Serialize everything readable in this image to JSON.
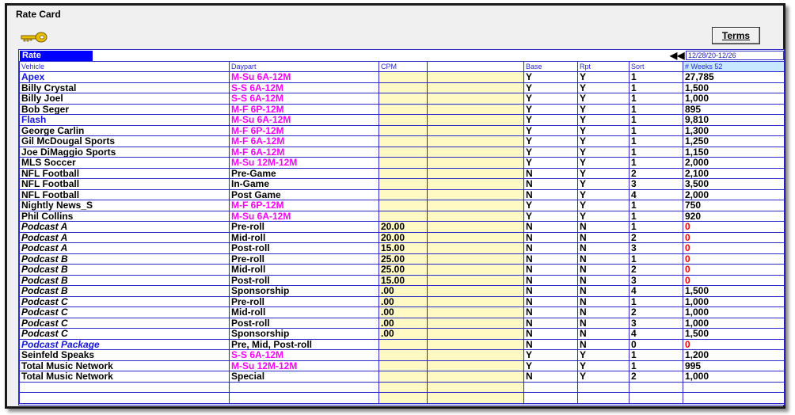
{
  "window": {
    "title": "Rate Card"
  },
  "toolbar": {
    "terms_label": "Terms",
    "key_icon": "key-icon"
  },
  "grid": {
    "tab_label": "Rate",
    "date_range": "12/28/20-12/26",
    "columns": [
      "Vehicle",
      "Daypart",
      "CPM",
      "",
      "Base",
      "Rpt",
      "Sort",
      "# Weeks 52"
    ],
    "colors": {
      "link_blue": "#1515e0",
      "daypart_magenta": "#ff00ff",
      "zero_red": "#ff0000",
      "cpm_fill": "#fff9c4",
      "grid_line": "#2a2ad0"
    },
    "rows": [
      {
        "vehicle": "Apex",
        "vehicle_style": "blue",
        "daypart": "M-Su 6A-12M",
        "daypart_style": "magenta",
        "cpm": "",
        "base": "Y",
        "rpt": "Y",
        "sort": "1",
        "weeks": "27,785",
        "weeks_style": ""
      },
      {
        "vehicle": "Billy Crystal",
        "vehicle_style": "",
        "daypart": "S-S 6A-12M",
        "daypart_style": "magenta",
        "cpm": "",
        "base": "Y",
        "rpt": "Y",
        "sort": "1",
        "weeks": "1,500",
        "weeks_style": ""
      },
      {
        "vehicle": "Billy Joel",
        "vehicle_style": "",
        "daypart": "S-S 6A-12M",
        "daypart_style": "magenta",
        "cpm": "",
        "base": "Y",
        "rpt": "Y",
        "sort": "1",
        "weeks": "1,000",
        "weeks_style": ""
      },
      {
        "vehicle": "Bob Seger",
        "vehicle_style": "",
        "daypart": "M-F 6P-12M",
        "daypart_style": "magenta",
        "cpm": "",
        "base": "Y",
        "rpt": "Y",
        "sort": "1",
        "weeks": "895",
        "weeks_style": ""
      },
      {
        "vehicle": "Flash",
        "vehicle_style": "blue",
        "daypart": "M-Su 6A-12M",
        "daypart_style": "magenta",
        "cpm": "",
        "base": "Y",
        "rpt": "Y",
        "sort": "1",
        "weeks": "9,810",
        "weeks_style": ""
      },
      {
        "vehicle": "George Carlin",
        "vehicle_style": "",
        "daypart": "M-F 6P-12M",
        "daypart_style": "magenta",
        "cpm": "",
        "base": "Y",
        "rpt": "Y",
        "sort": "1",
        "weeks": "1,300",
        "weeks_style": ""
      },
      {
        "vehicle": "Gil McDougal Sports",
        "vehicle_style": "",
        "daypart": "M-F 6A-12M",
        "daypart_style": "magenta",
        "cpm": "",
        "base": "Y",
        "rpt": "Y",
        "sort": "1",
        "weeks": "1,250",
        "weeks_style": ""
      },
      {
        "vehicle": "Joe DiMaggio Sports",
        "vehicle_style": "",
        "daypart": "M-F 6A-12M",
        "daypart_style": "magenta",
        "cpm": "",
        "base": "Y",
        "rpt": "Y",
        "sort": "1",
        "weeks": "1,150",
        "weeks_style": ""
      },
      {
        "vehicle": "MLS Soccer",
        "vehicle_style": "",
        "daypart": "M-Su 12M-12M",
        "daypart_style": "magenta",
        "cpm": "",
        "base": "Y",
        "rpt": "Y",
        "sort": "1",
        "weeks": "2,000",
        "weeks_style": ""
      },
      {
        "vehicle": "NFL Football",
        "vehicle_style": "",
        "daypart": "Pre-Game",
        "daypart_style": "",
        "cpm": "",
        "base": "N",
        "rpt": "Y",
        "sort": "2",
        "weeks": "2,100",
        "weeks_style": ""
      },
      {
        "vehicle": "NFL Football",
        "vehicle_style": "",
        "daypart": "In-Game",
        "daypart_style": "",
        "cpm": "",
        "base": "N",
        "rpt": "Y",
        "sort": "3",
        "weeks": "3,500",
        "weeks_style": ""
      },
      {
        "vehicle": "NFL Football",
        "vehicle_style": "",
        "daypart": "Post Game",
        "daypart_style": "",
        "cpm": "",
        "base": "N",
        "rpt": "Y",
        "sort": "4",
        "weeks": "2,000",
        "weeks_style": ""
      },
      {
        "vehicle": "Nightly News_S",
        "vehicle_style": "",
        "daypart": "M-F 6P-12M",
        "daypart_style": "magenta",
        "cpm": "",
        "base": "Y",
        "rpt": "Y",
        "sort": "1",
        "weeks": "750",
        "weeks_style": ""
      },
      {
        "vehicle": "Phil Collins",
        "vehicle_style": "",
        "daypart": "M-Su 6A-12M",
        "daypart_style": "magenta",
        "cpm": "",
        "base": "Y",
        "rpt": "Y",
        "sort": "1",
        "weeks": "920",
        "weeks_style": ""
      },
      {
        "vehicle": "Podcast A",
        "vehicle_style": "italic",
        "daypart": "Pre-roll",
        "daypart_style": "",
        "cpm": "20.00",
        "base": "N",
        "rpt": "N",
        "sort": "1",
        "weeks": "0",
        "weeks_style": "red"
      },
      {
        "vehicle": "Podcast A",
        "vehicle_style": "italic",
        "daypart": "Mid-roll",
        "daypart_style": "",
        "cpm": "20.00",
        "base": "N",
        "rpt": "N",
        "sort": "2",
        "weeks": "0",
        "weeks_style": "red"
      },
      {
        "vehicle": "Podcast A",
        "vehicle_style": "italic",
        "daypart": "Post-roll",
        "daypart_style": "",
        "cpm": "15.00",
        "base": "N",
        "rpt": "N",
        "sort": "3",
        "weeks": "0",
        "weeks_style": "red"
      },
      {
        "vehicle": "Podcast B",
        "vehicle_style": "italic",
        "daypart": "Pre-roll",
        "daypart_style": "",
        "cpm": "25.00",
        "base": "N",
        "rpt": "N",
        "sort": "1",
        "weeks": "0",
        "weeks_style": "red"
      },
      {
        "vehicle": "Podcast B",
        "vehicle_style": "italic",
        "daypart": "Mid-roll",
        "daypart_style": "",
        "cpm": "25.00",
        "base": "N",
        "rpt": "N",
        "sort": "2",
        "weeks": "0",
        "weeks_style": "red"
      },
      {
        "vehicle": "Podcast B",
        "vehicle_style": "italic",
        "daypart": "Post-roll",
        "daypart_style": "",
        "cpm": "15.00",
        "base": "N",
        "rpt": "N",
        "sort": "3",
        "weeks": "0",
        "weeks_style": "red"
      },
      {
        "vehicle": "Podcast B",
        "vehicle_style": "italic",
        "daypart": "Sponsorship",
        "daypart_style": "",
        "cpm": ".00",
        "base": "N",
        "rpt": "N",
        "sort": "4",
        "weeks": "1,500",
        "weeks_style": ""
      },
      {
        "vehicle": "Podcast C",
        "vehicle_style": "italic",
        "daypart": "Pre-roll",
        "daypart_style": "",
        "cpm": ".00",
        "base": "N",
        "rpt": "N",
        "sort": "1",
        "weeks": "1,000",
        "weeks_style": ""
      },
      {
        "vehicle": "Podcast C",
        "vehicle_style": "italic",
        "daypart": "Mid-roll",
        "daypart_style": "",
        "cpm": ".00",
        "base": "N",
        "rpt": "N",
        "sort": "2",
        "weeks": "1,000",
        "weeks_style": ""
      },
      {
        "vehicle": "Podcast C",
        "vehicle_style": "italic",
        "daypart": "Post-roll",
        "daypart_style": "",
        "cpm": ".00",
        "base": "N",
        "rpt": "N",
        "sort": "3",
        "weeks": "1,000",
        "weeks_style": ""
      },
      {
        "vehicle": "Podcast C",
        "vehicle_style": "italic",
        "daypart": "Sponsorship",
        "daypart_style": "",
        "cpm": ".00",
        "base": "N",
        "rpt": "N",
        "sort": "4",
        "weeks": "1,500",
        "weeks_style": ""
      },
      {
        "vehicle": "Podcast Package",
        "vehicle_style": "blue-italic",
        "daypart": "Pre, Mid, Post-roll",
        "daypart_style": "",
        "cpm": "",
        "base": "N",
        "rpt": "N",
        "sort": "0",
        "weeks": "0",
        "weeks_style": "red"
      },
      {
        "vehicle": "Seinfeld Speaks",
        "vehicle_style": "",
        "daypart": "S-S 6A-12M",
        "daypart_style": "magenta",
        "cpm": "",
        "base": "Y",
        "rpt": "Y",
        "sort": "1",
        "weeks": "1,200",
        "weeks_style": ""
      },
      {
        "vehicle": "Total Music Network",
        "vehicle_style": "",
        "daypart": "M-Su 12M-12M",
        "daypart_style": "magenta",
        "cpm": "",
        "base": "Y",
        "rpt": "Y",
        "sort": "1",
        "weeks": "995",
        "weeks_style": ""
      },
      {
        "vehicle": "Total Music Network",
        "vehicle_style": "",
        "daypart": "Special",
        "daypart_style": "",
        "cpm": "",
        "base": "N",
        "rpt": "Y",
        "sort": "2",
        "weeks": "1,000",
        "weeks_style": ""
      }
    ],
    "empty_rows": 2
  }
}
